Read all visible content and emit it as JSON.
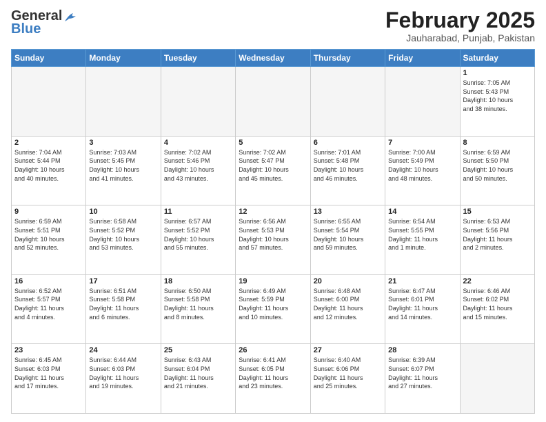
{
  "header": {
    "logo_general": "General",
    "logo_blue": "Blue",
    "month_title": "February 2025",
    "location": "Jauharabad, Punjab, Pakistan"
  },
  "days_of_week": [
    "Sunday",
    "Monday",
    "Tuesday",
    "Wednesday",
    "Thursday",
    "Friday",
    "Saturday"
  ],
  "weeks": [
    [
      {
        "day": "",
        "info": ""
      },
      {
        "day": "",
        "info": ""
      },
      {
        "day": "",
        "info": ""
      },
      {
        "day": "",
        "info": ""
      },
      {
        "day": "",
        "info": ""
      },
      {
        "day": "",
        "info": ""
      },
      {
        "day": "1",
        "info": "Sunrise: 7:05 AM\nSunset: 5:43 PM\nDaylight: 10 hours\nand 38 minutes."
      }
    ],
    [
      {
        "day": "2",
        "info": "Sunrise: 7:04 AM\nSunset: 5:44 PM\nDaylight: 10 hours\nand 40 minutes."
      },
      {
        "day": "3",
        "info": "Sunrise: 7:03 AM\nSunset: 5:45 PM\nDaylight: 10 hours\nand 41 minutes."
      },
      {
        "day": "4",
        "info": "Sunrise: 7:02 AM\nSunset: 5:46 PM\nDaylight: 10 hours\nand 43 minutes."
      },
      {
        "day": "5",
        "info": "Sunrise: 7:02 AM\nSunset: 5:47 PM\nDaylight: 10 hours\nand 45 minutes."
      },
      {
        "day": "6",
        "info": "Sunrise: 7:01 AM\nSunset: 5:48 PM\nDaylight: 10 hours\nand 46 minutes."
      },
      {
        "day": "7",
        "info": "Sunrise: 7:00 AM\nSunset: 5:49 PM\nDaylight: 10 hours\nand 48 minutes."
      },
      {
        "day": "8",
        "info": "Sunrise: 6:59 AM\nSunset: 5:50 PM\nDaylight: 10 hours\nand 50 minutes."
      }
    ],
    [
      {
        "day": "9",
        "info": "Sunrise: 6:59 AM\nSunset: 5:51 PM\nDaylight: 10 hours\nand 52 minutes."
      },
      {
        "day": "10",
        "info": "Sunrise: 6:58 AM\nSunset: 5:52 PM\nDaylight: 10 hours\nand 53 minutes."
      },
      {
        "day": "11",
        "info": "Sunrise: 6:57 AM\nSunset: 5:52 PM\nDaylight: 10 hours\nand 55 minutes."
      },
      {
        "day": "12",
        "info": "Sunrise: 6:56 AM\nSunset: 5:53 PM\nDaylight: 10 hours\nand 57 minutes."
      },
      {
        "day": "13",
        "info": "Sunrise: 6:55 AM\nSunset: 5:54 PM\nDaylight: 10 hours\nand 59 minutes."
      },
      {
        "day": "14",
        "info": "Sunrise: 6:54 AM\nSunset: 5:55 PM\nDaylight: 11 hours\nand 1 minute."
      },
      {
        "day": "15",
        "info": "Sunrise: 6:53 AM\nSunset: 5:56 PM\nDaylight: 11 hours\nand 2 minutes."
      }
    ],
    [
      {
        "day": "16",
        "info": "Sunrise: 6:52 AM\nSunset: 5:57 PM\nDaylight: 11 hours\nand 4 minutes."
      },
      {
        "day": "17",
        "info": "Sunrise: 6:51 AM\nSunset: 5:58 PM\nDaylight: 11 hours\nand 6 minutes."
      },
      {
        "day": "18",
        "info": "Sunrise: 6:50 AM\nSunset: 5:58 PM\nDaylight: 11 hours\nand 8 minutes."
      },
      {
        "day": "19",
        "info": "Sunrise: 6:49 AM\nSunset: 5:59 PM\nDaylight: 11 hours\nand 10 minutes."
      },
      {
        "day": "20",
        "info": "Sunrise: 6:48 AM\nSunset: 6:00 PM\nDaylight: 11 hours\nand 12 minutes."
      },
      {
        "day": "21",
        "info": "Sunrise: 6:47 AM\nSunset: 6:01 PM\nDaylight: 11 hours\nand 14 minutes."
      },
      {
        "day": "22",
        "info": "Sunrise: 6:46 AM\nSunset: 6:02 PM\nDaylight: 11 hours\nand 15 minutes."
      }
    ],
    [
      {
        "day": "23",
        "info": "Sunrise: 6:45 AM\nSunset: 6:03 PM\nDaylight: 11 hours\nand 17 minutes."
      },
      {
        "day": "24",
        "info": "Sunrise: 6:44 AM\nSunset: 6:03 PM\nDaylight: 11 hours\nand 19 minutes."
      },
      {
        "day": "25",
        "info": "Sunrise: 6:43 AM\nSunset: 6:04 PM\nDaylight: 11 hours\nand 21 minutes."
      },
      {
        "day": "26",
        "info": "Sunrise: 6:41 AM\nSunset: 6:05 PM\nDaylight: 11 hours\nand 23 minutes."
      },
      {
        "day": "27",
        "info": "Sunrise: 6:40 AM\nSunset: 6:06 PM\nDaylight: 11 hours\nand 25 minutes."
      },
      {
        "day": "28",
        "info": "Sunrise: 6:39 AM\nSunset: 6:07 PM\nDaylight: 11 hours\nand 27 minutes."
      },
      {
        "day": "",
        "info": ""
      }
    ]
  ]
}
